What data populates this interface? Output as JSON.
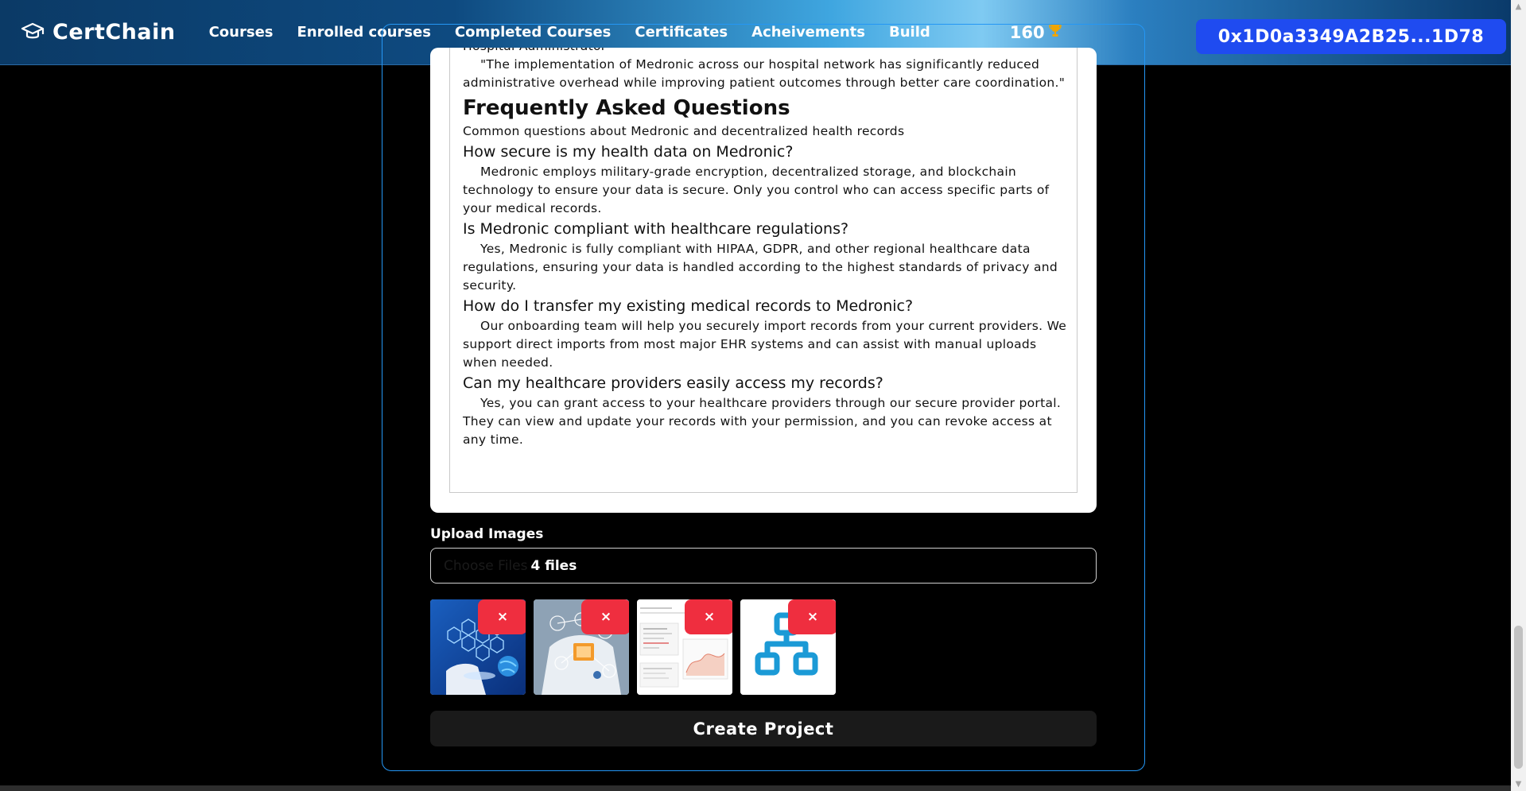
{
  "header": {
    "brand": "CertChain",
    "brand_icon": "graduation-cap-icon",
    "nav": [
      "Courses",
      "Enrolled courses",
      "Completed Courses",
      "Certificates",
      "Acheivements",
      "Build"
    ],
    "points": "160",
    "points_icon": "trophy-icon",
    "wallet": "0x1D0a3349A2B25...1D78"
  },
  "editor": {
    "cut_line": "Hospital Administrator",
    "quote": "\"The implementation of Medronic across our hospital network has significantly reduced administrative overhead while improving patient outcomes through better care coordination.\"",
    "faq_title": "Frequently Asked Questions",
    "faq_subtitle": "Common questions about Medronic and decentralized health records",
    "faqs": [
      {
        "q": "How secure is my health data on Medronic?",
        "a": "Medronic employs military-grade encryption, decentralized storage, and blockchain technology to ensure your data is secure. Only you control who can access specific parts of your medical records."
      },
      {
        "q": "Is Medronic compliant with healthcare regulations?",
        "a": "Yes, Medronic is fully compliant with HIPAA, GDPR, and other regional healthcare data regulations, ensuring your data is handled according to the highest standards of privacy and security."
      },
      {
        "q": "How do I transfer my existing medical records to Medronic?",
        "a": "Our onboarding team will help you securely import records from your current providers. We support direct imports from most major EHR systems and can assist with manual uploads when needed."
      },
      {
        "q": "Can my healthcare providers easily access my records?",
        "a": "Yes, you can grant access to your healthcare providers through our secure provider portal. They can view and update your records with your permission, and you can revoke access at any time."
      }
    ]
  },
  "upload": {
    "label": "Upload Images",
    "button_text": "Choose Files",
    "file_count": "4 files",
    "remove_label": "×"
  },
  "create_button": "Create Project",
  "colors": {
    "accent": "#2497f5",
    "wallet_bg": "#1f4bf0",
    "remove_bg": "#ef2e3f"
  }
}
